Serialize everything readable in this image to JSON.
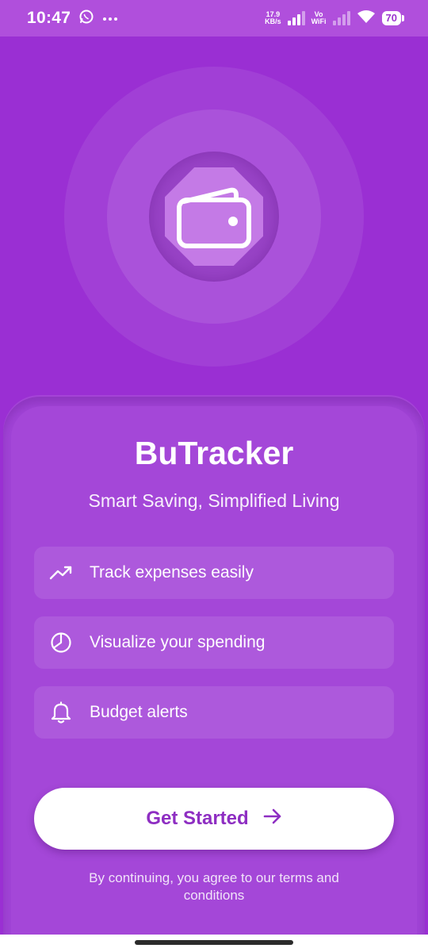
{
  "status_bar": {
    "time": "10:47",
    "net_speed_value": "17.9",
    "net_speed_unit": "KB/s",
    "volte_top": "Vo",
    "volte_bottom": "WiFi",
    "battery": "70",
    "icons": [
      "whatsapp-icon",
      "more-icon",
      "signal-icon",
      "wifi-icon",
      "battery-icon"
    ]
  },
  "hero": {
    "icon": "wallet-icon"
  },
  "app": {
    "title": "BuTracker",
    "tagline": "Smart Saving, Simplified Living"
  },
  "features": [
    {
      "icon": "trending-up-icon",
      "label": "Track expenses easily"
    },
    {
      "icon": "pie-chart-icon",
      "label": "Visualize your spending"
    },
    {
      "icon": "bell-icon",
      "label": "Budget alerts"
    }
  ],
  "cta": {
    "label": "Get Started",
    "icon": "arrow-right-icon"
  },
  "terms": "By continuing, you agree to our terms and conditions",
  "colors": {
    "background": "#9a2fd3",
    "card": "#a447d8",
    "accent_text": "#8e2ec2",
    "button": "#ffffff"
  }
}
